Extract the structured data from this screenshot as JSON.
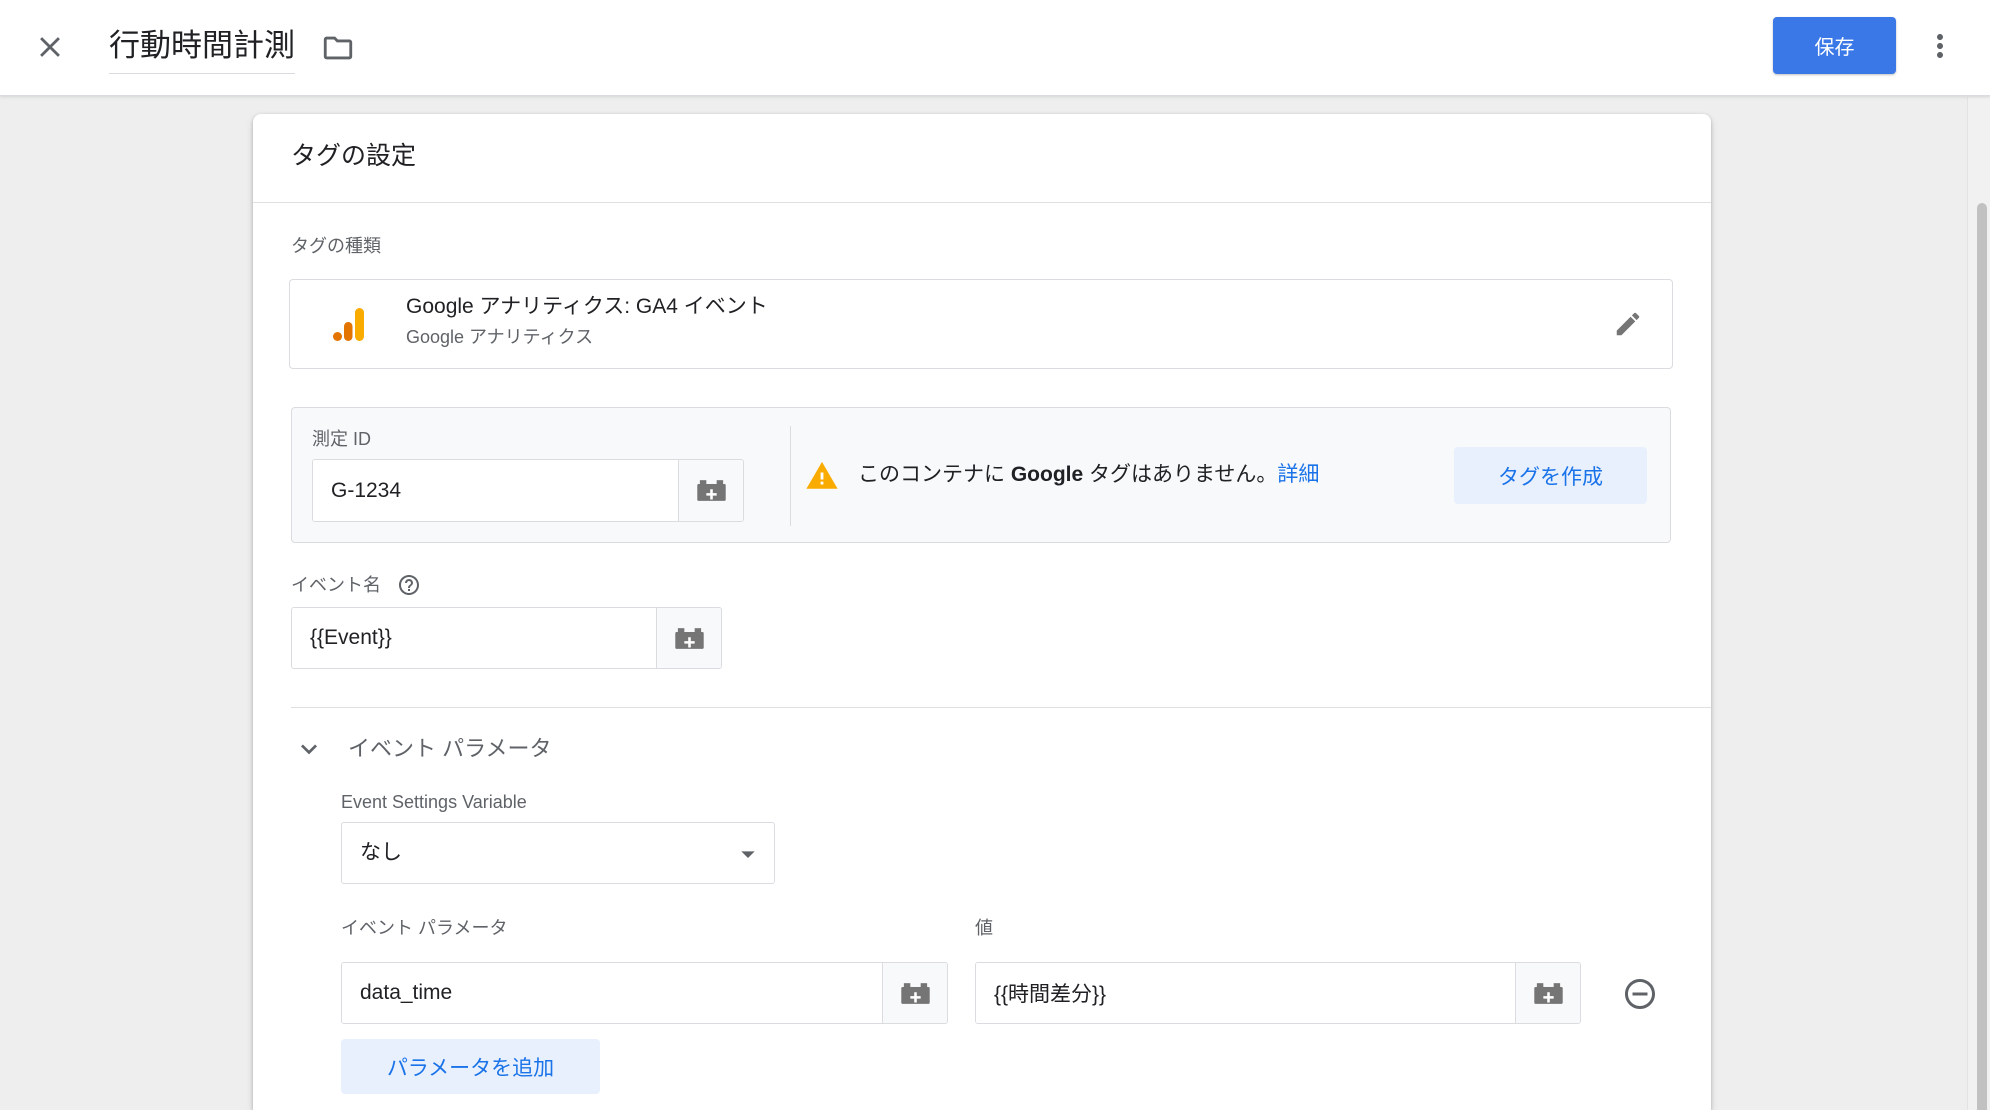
{
  "colors": {
    "accent": "#3b78e7",
    "link": "#1a73e8",
    "soft": "#e8f0fe",
    "warning": "#f9ab00",
    "ga_orange": "#e37400",
    "ga_yellow": "#f9ab00"
  },
  "icons": {
    "close": "close-icon",
    "folder": "folder-icon",
    "more": "more-vert-icon",
    "tag_type": "google-analytics-icon",
    "edit": "pencil-icon",
    "variable": "variable-brick-icon",
    "warning": "warning-icon",
    "help": "help-icon",
    "expand": "chevron-down-icon",
    "dropdown": "dropdown-arrow-icon",
    "remove": "remove-circle-icon"
  },
  "header": {
    "title": "行動時間計測",
    "save_label": "保存"
  },
  "tag_config": {
    "title": "タグの設定",
    "tag_type": {
      "label": "タグの種類",
      "name": "Google アナリティクス: GA4 イベント",
      "provider": "Google アナリティクス"
    },
    "measurement_id": {
      "label": "測定 ID",
      "value": "G-1234",
      "notice_before": "このコンテナに",
      "notice_brand": "Google",
      "notice_after": "タグはありません。",
      "notice_link": "詳細",
      "create_tag_label": "タグを作成"
    },
    "event_name": {
      "label": "イベント名",
      "value": "{{Event}}"
    },
    "event_parameters": {
      "section_title": "イベント パラメータ",
      "settings_variable_label": "Event Settings Variable",
      "settings_variable_value": "なし",
      "param_column_label": "イベント パラメータ",
      "value_column_label": "値",
      "rows": [
        {
          "param": "data_time",
          "value": "{{時間差分}}"
        }
      ],
      "add_label": "パラメータを追加"
    }
  }
}
